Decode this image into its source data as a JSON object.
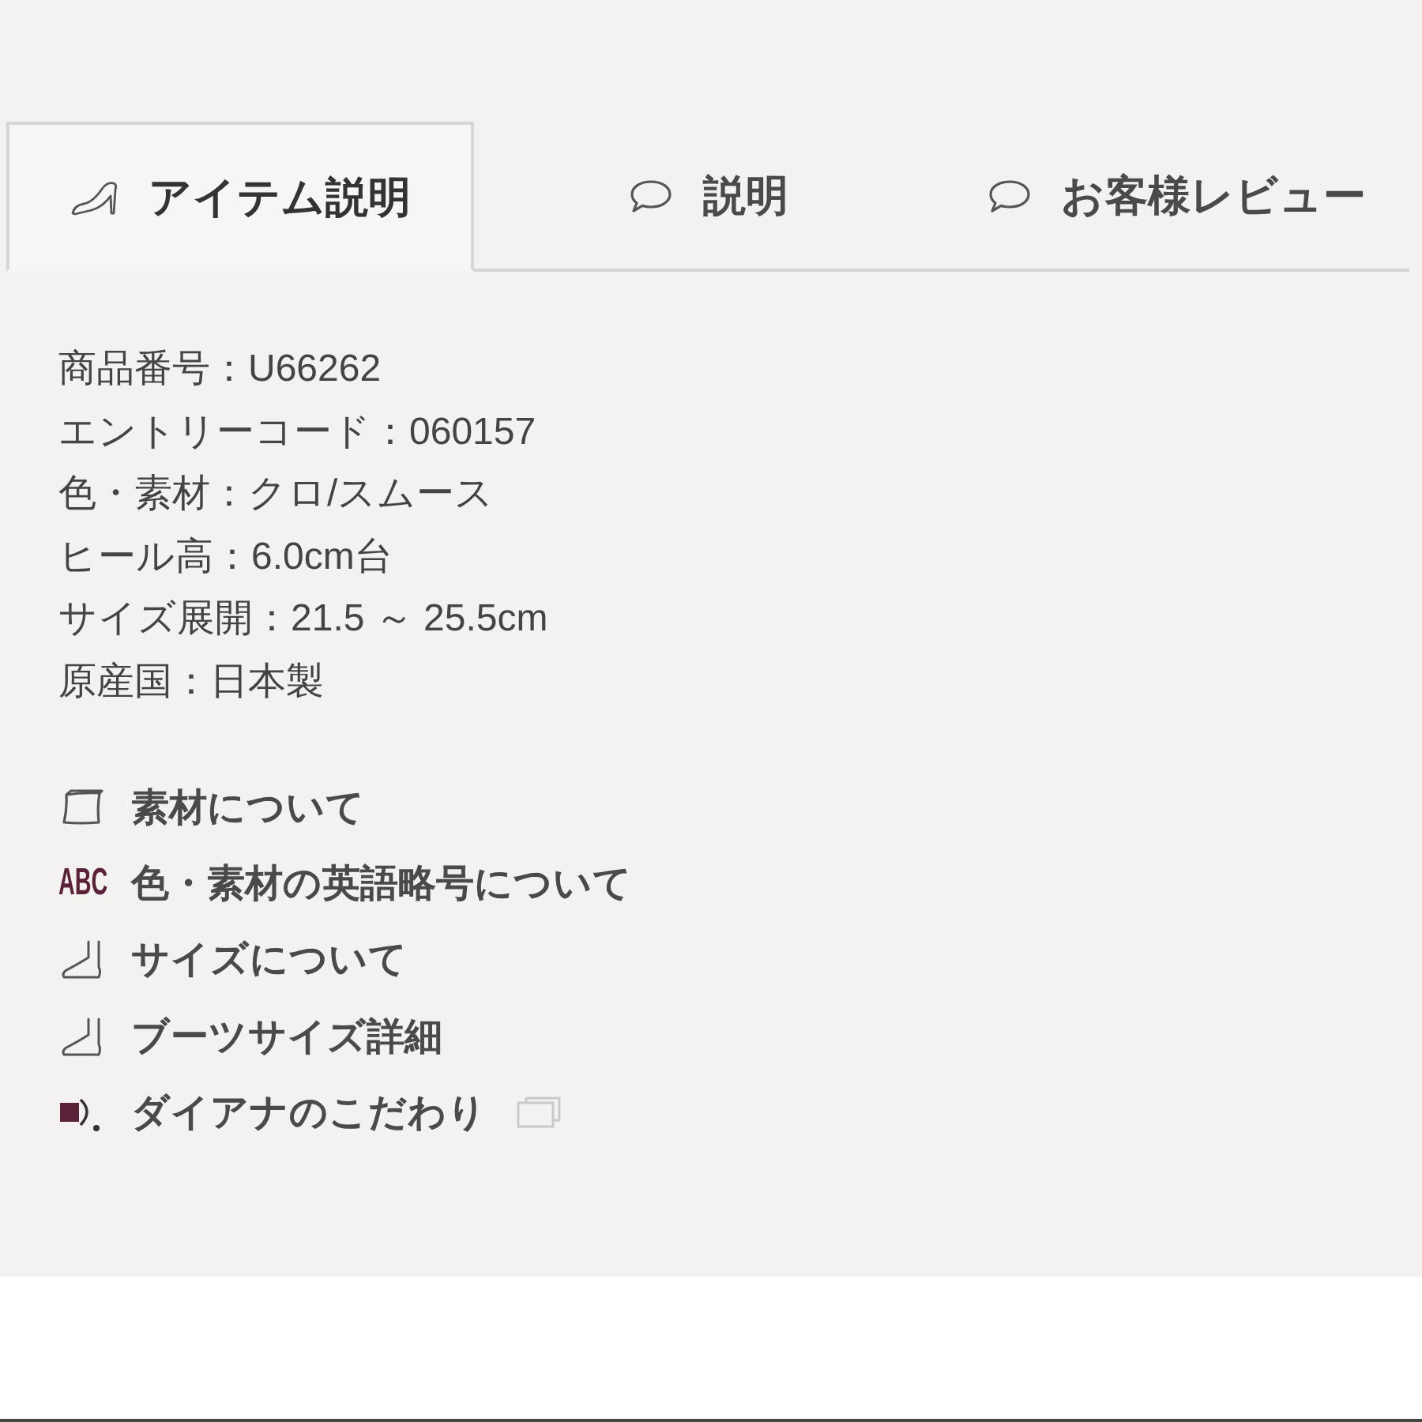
{
  "tabs": [
    {
      "label": "アイテム説明",
      "kind": "shoe",
      "selected": true
    },
    {
      "label": "説明",
      "kind": "speech",
      "selected": false
    },
    {
      "label": "お客様レビュー",
      "kind": "speech",
      "selected": false
    }
  ],
  "specs": [
    "商品番号：U66262",
    "エントリーコード：060157",
    "色・素材：クロ/スムース",
    "ヒール高：6.0cm台",
    "サイズ展開：21.5 ～ 25.5cm",
    "原産国：日本製"
  ],
  "links": [
    {
      "label": "素材について",
      "kind": "fabric",
      "external": false
    },
    {
      "label": "色・素材の英語略号について",
      "kind": "abbreviation",
      "icon_text": "ABC",
      "external": false
    },
    {
      "label": "サイズについて",
      "kind": "foot",
      "external": false
    },
    {
      "label": "ブーツサイズ詳細",
      "kind": "foot",
      "external": false
    },
    {
      "label": "ダイアナのこだわり",
      "kind": "brand",
      "external": true
    }
  ]
}
